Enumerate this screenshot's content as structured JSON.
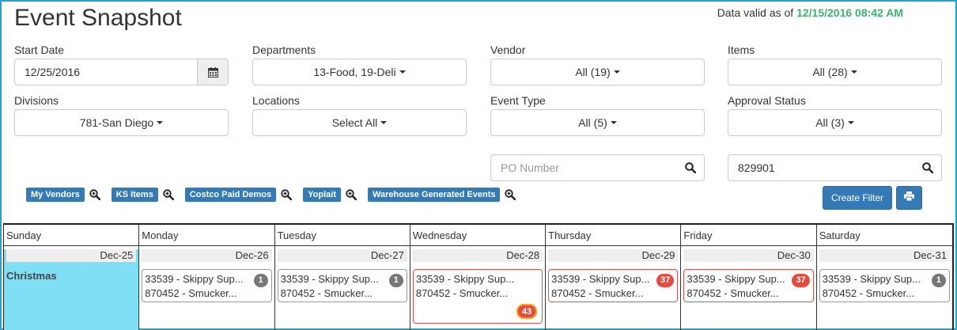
{
  "page": {
    "title": "Event Snapshot",
    "valid_prefix": "Data valid as of",
    "valid_timestamp": "12/15/2016 08:42 AM"
  },
  "filters": {
    "start_date": {
      "label": "Start Date",
      "value": "12/25/2016",
      "icon": "calendar-icon"
    },
    "departments": {
      "label": "Departments",
      "value": "13-Food, 19-Deli"
    },
    "vendor": {
      "label": "Vendor",
      "value": "All (19)"
    },
    "items": {
      "label": "Items",
      "value": "All (28)"
    },
    "divisions": {
      "label": "Divisions",
      "value": "781-San Diego"
    },
    "locations": {
      "label": "Locations",
      "value": "Select All"
    },
    "event_type": {
      "label": "Event Type",
      "value": "All (5)"
    },
    "approval_status": {
      "label": "Approval Status",
      "value": "All (3)"
    },
    "po_number": {
      "placeholder": "PO Number",
      "value": ""
    },
    "item_search": {
      "value": "829901"
    }
  },
  "saved_filters": [
    "My Vendors",
    "KS Items",
    "Costco Paid Demos",
    "Yoplait",
    "Warehouse Generated Events"
  ],
  "buttons": {
    "create_filter": "Create Filter",
    "print_icon": "print-icon"
  },
  "calendar": {
    "days": [
      {
        "name": "Sunday",
        "date": "Dec-25",
        "holiday": "Christmas",
        "events": []
      },
      {
        "name": "Monday",
        "date": "Dec-26",
        "events": [
          {
            "line1": "33539 - Skippy Sup...",
            "line2": "870452 - Smucker...",
            "badge": "1"
          }
        ]
      },
      {
        "name": "Tuesday",
        "date": "Dec-27",
        "events": [
          {
            "line1": "33539 - Skippy Sup...",
            "line2": "870452 - Smucker...",
            "badge": "1"
          }
        ]
      },
      {
        "name": "Wednesday",
        "date": "Dec-28",
        "events": [
          {
            "line1": "33539 - Skippy Sup...",
            "line2": "870452 - Smucker...",
            "badge": "43"
          }
        ]
      },
      {
        "name": "Thursday",
        "date": "Dec-29",
        "events": [
          {
            "line1": "33539 - Skippy Sup...",
            "line2": "870452 - Smucker...",
            "badge": "37"
          }
        ]
      },
      {
        "name": "Friday",
        "date": "Dec-30",
        "events": [
          {
            "line1": "33539 - Skippy Sup...",
            "line2": "870452 - Smucker...",
            "badge": "37"
          }
        ]
      },
      {
        "name": "Saturday",
        "date": "Dec-31",
        "events": [
          {
            "line1": "33539 - Skippy Sup...",
            "line2": "870452 - Smucker...",
            "badge": "1"
          }
        ]
      }
    ]
  },
  "colors": {
    "accent": "#337ab7",
    "valid_green": "#3cb371",
    "holiday_bg": "#7fe0f5",
    "badge_red": "#e84a3c",
    "badge_gray": "#777777",
    "frame": "#1ba7d6"
  }
}
